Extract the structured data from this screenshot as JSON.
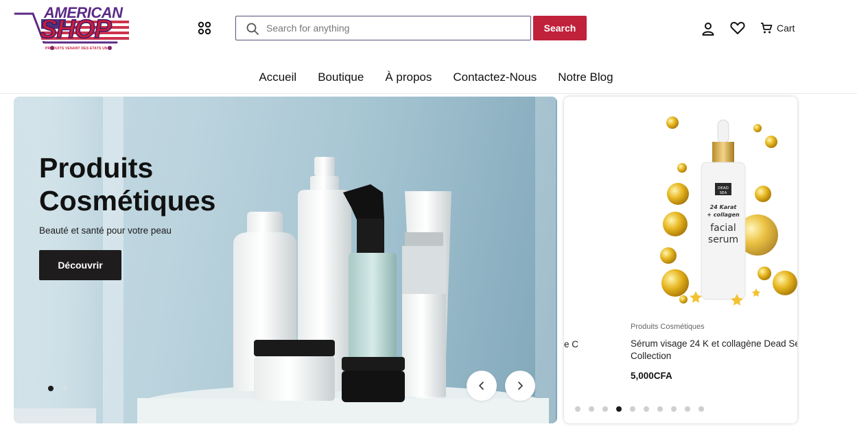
{
  "header": {
    "logo": {
      "line1": "AMERICAN",
      "line2": "SHOP",
      "tagline": "PRODUITS VENANT DES ETATS UNIS"
    },
    "search": {
      "placeholder": "Search for anything",
      "button_label": "Search"
    },
    "cart_label": "Cart",
    "icons": [
      "grid-icon",
      "search-icon",
      "user-icon",
      "heart-icon",
      "cart-icon"
    ]
  },
  "nav": {
    "items": [
      "Accueil",
      "Boutique",
      "À propos",
      "Contactez-Nous",
      "Notre Blog"
    ]
  },
  "hero": {
    "title_line1": "Produits",
    "title_line2": "Cosmétiques",
    "subtitle": "Beauté et santé pour votre peau",
    "button_label": "Découvrir",
    "slide_count": 2,
    "active_slide": 1
  },
  "product_carousel": {
    "partial_previous_text": "e C",
    "product": {
      "category": "Produits Cosmétiques",
      "title_line1": "Sérum visage 24 K et collagène Dead Se",
      "title_line2": "Collection",
      "price": "5,000CFA",
      "image_label": {
        "brand_line1": "DEAD",
        "brand_line2": "SEA",
        "line1": "24 Karat",
        "line2": "+ collagen",
        "line3": "facial",
        "line4": "serum"
      }
    },
    "dot_count": 10,
    "active_dot": 4
  },
  "colors": {
    "accent": "#c0213b",
    "brand_purple": "#5b2a86",
    "dark_button": "#1e1c1c"
  }
}
